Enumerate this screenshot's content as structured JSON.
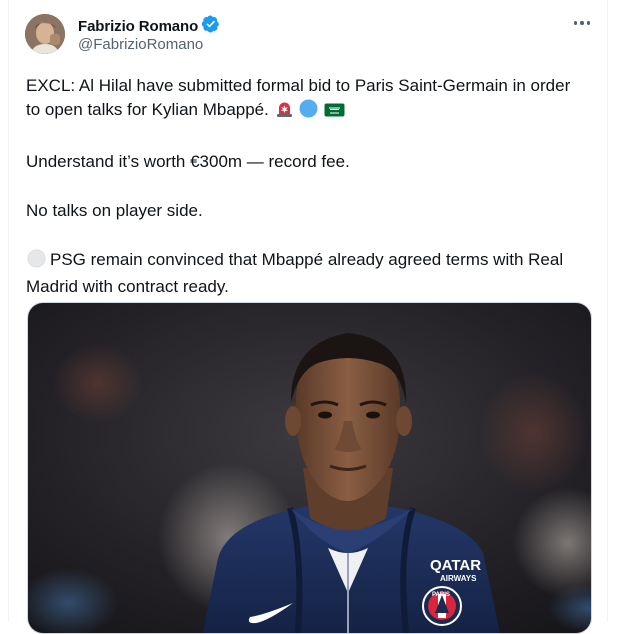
{
  "tweet": {
    "author_name": "Fabrizio Romano",
    "handle": "@FabrizioRomano",
    "paragraphs": [
      {
        "text": "EXCL: Al Hilal have submitted formal bid to Paris Saint-Germain in order to open talks for Kylian Mbappé.",
        "emojis": [
          "rotating-light-emoji",
          "blue-circle-emoji",
          "saudi-flag-emoji"
        ]
      },
      {
        "text": "Understand it’s worth €300m — record fee.",
        "emojis": []
      },
      {
        "text": "No talks on player side.",
        "emojis": []
      },
      {
        "text": "PSG remain convinced that Mbappé already agreed terms with Real Madrid with contract ready.",
        "emojis": [],
        "leading_emoji": "white-circle-emoji"
      }
    ],
    "media": {
      "jersey_sponsor": "QATAR",
      "jersey_sponsor_sub": "AIRWAYS",
      "crest_text": "PARIS"
    }
  },
  "colors": {
    "verified_blue": "#1d9bf0",
    "secondary_text": "#536471",
    "psg_navy": "#1b2a4e"
  }
}
